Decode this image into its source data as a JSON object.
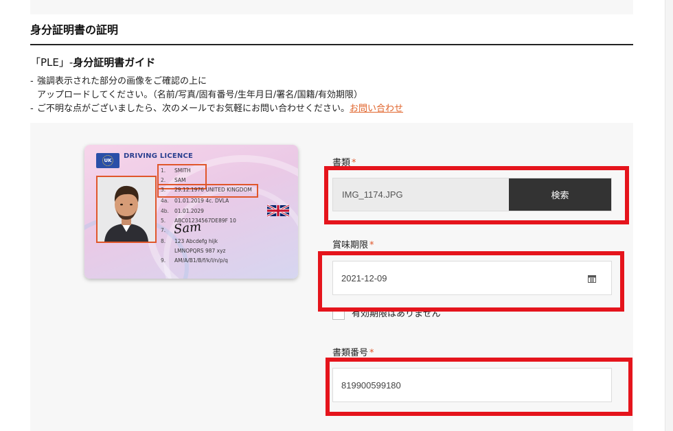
{
  "section": {
    "title": "身分証明書の証明"
  },
  "guide": {
    "title_prefix": "「PLE」-",
    "title_bold": "身分証明書ガイド",
    "notes": [
      "強調表示された部分の画像をご確認の上に",
      "アップロードしてください。（名前/写真/固有番号/生年月日/署名/国籍/有効期限）",
      "ご不明な点がございましたら、次のメールでお気軽にお問い合わせください。"
    ],
    "contact_link": "お問い合わせ"
  },
  "card": {
    "flag_text": "UK",
    "title": "DRIVING LICENCE",
    "lines": [
      {
        "num": "1.",
        "text": "SMITH"
      },
      {
        "num": "2.",
        "text": "SAM"
      },
      {
        "num": "3.",
        "text": "29.12.1976 UNITED KINGDOM"
      },
      {
        "num": "4a.",
        "text": "01.01.2019   4c. DVLA"
      },
      {
        "num": "4b.",
        "text": "01.01.2029"
      },
      {
        "num": "5.",
        "text": "ABC01234567DE89F 10"
      },
      {
        "num": "7.",
        "text": ""
      },
      {
        "num": "8.",
        "text": "123 Abcdefg hijk"
      },
      {
        "num": "",
        "text": "LMNOPQRS 987 xyz"
      },
      {
        "num": "9.",
        "text": "AM/A/B1/B/f/k/l/n/p/q"
      }
    ],
    "signature": "Sam"
  },
  "form": {
    "document": {
      "label": "書類",
      "required": "*",
      "file_name": "IMG_1174.JPG",
      "button": "検索"
    },
    "expiry": {
      "label": "賞味期限",
      "required": "*",
      "value": "2021-12-09",
      "no_expiry_label": "有効期限はありません"
    },
    "doc_number": {
      "label": "書類番号",
      "required": "*",
      "value": "819900599180"
    }
  },
  "colors": {
    "accent": "#e0562a",
    "highlight": "#e5141c",
    "button": "#333333",
    "link": "#e0632a"
  }
}
